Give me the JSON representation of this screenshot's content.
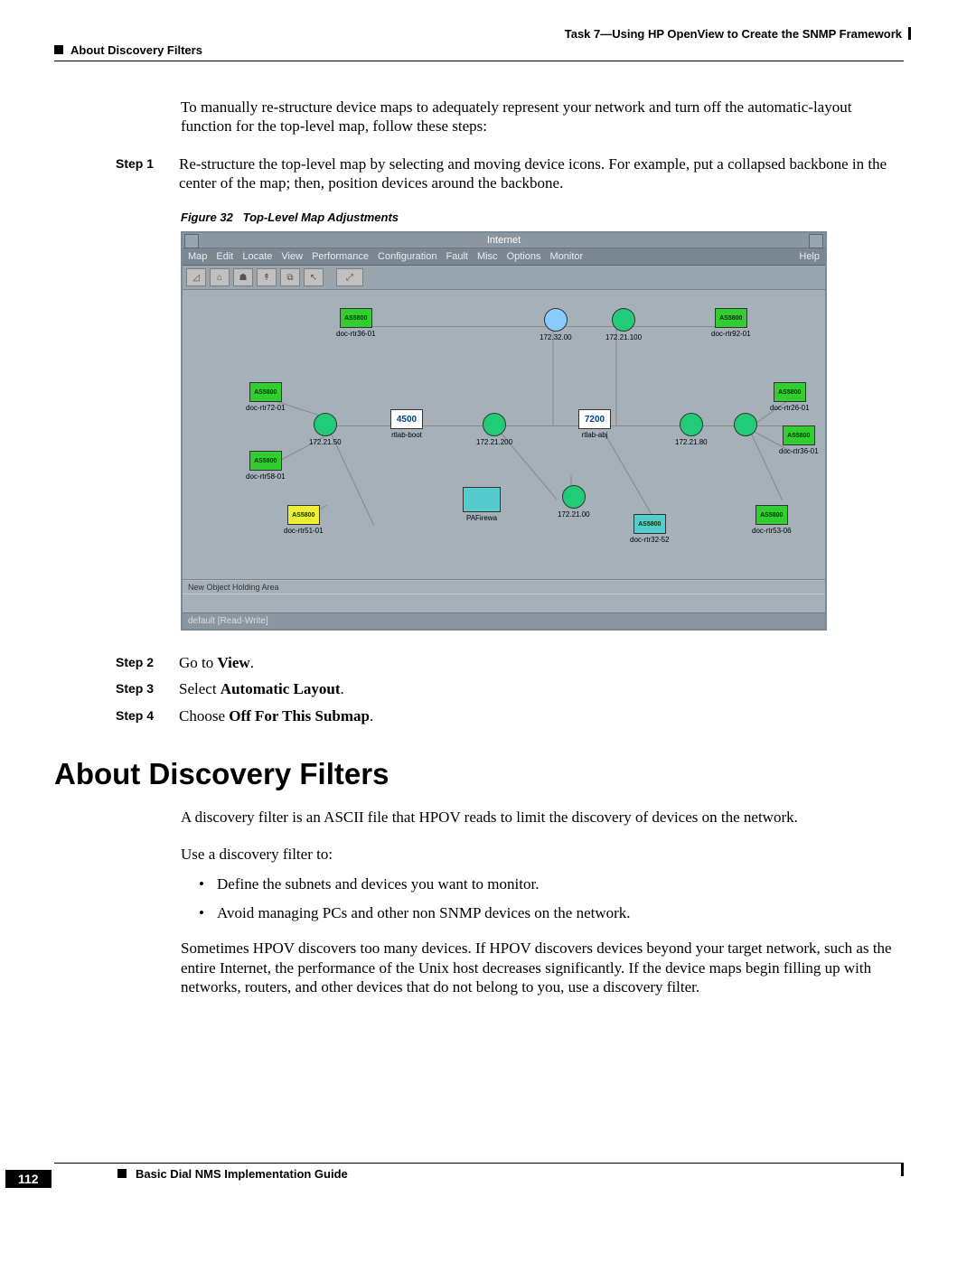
{
  "header": {
    "left": "About Discovery Filters",
    "right": "Task 7—Using HP OpenView to Create the SNMP Framework"
  },
  "intro": "To manually re-structure device maps to adequately represent your network and turn off the automatic-layout function for the top-level map, follow these steps:",
  "steps": [
    {
      "label": "Step 1",
      "text_prefix": "Re-structure the top-level map by selecting and moving device icons. For example, put a collapsed backbone in the center of the map; then, position devices around the backbone."
    },
    {
      "label": "Step 2",
      "text_prefix": "Go to ",
      "bold": "View",
      "suffix": "."
    },
    {
      "label": "Step 3",
      "text_prefix": "Select ",
      "bold": "Automatic Layout",
      "suffix": "."
    },
    {
      "label": "Step 4",
      "text_prefix": "Choose ",
      "bold": "Off For This Submap",
      "suffix": "."
    }
  ],
  "figure": {
    "label": "Figure 32",
    "title": "Top-Level Map Adjustments",
    "window_title": "Internet",
    "menus": [
      "Map",
      "Edit",
      "Locate",
      "View",
      "Performance",
      "Configuration",
      "Fault",
      "Misc",
      "Options",
      "Monitor"
    ],
    "menu_help": "Help",
    "status_area": "New Object Holding Area",
    "status_bottom": "default [Read-Write]",
    "nodes": {
      "n1": "doc-rtr36-01",
      "n2": "172.32.00",
      "n3": "172.21.100",
      "n4": "doc-rtr92-01",
      "n5": "doc-rtr72-01",
      "n6": "172.21.50",
      "n7": "4500",
      "n8": "172.21.200",
      "n9": "7200",
      "n10": "172.21.80",
      "n11": "doc-rtr26-01",
      "n12": "doc-rtr58-01",
      "n13": "doc-rtr51-01",
      "n14": "172.21.00",
      "n15": "doc-rtr32-52",
      "n16": "doc-rtr36-01",
      "n17": "doc-rtr53-06",
      "n18": "PAFirewa",
      "n7b": "rtlab-boot",
      "n9b": "rtlab-abj"
    }
  },
  "section": {
    "heading": "About Discovery Filters",
    "p1": "A discovery filter is an ASCII file that HPOV reads to limit the discovery of devices on the network.",
    "p2": "Use a discovery filter to:",
    "bullets": [
      "Define the subnets and devices you want to monitor.",
      "Avoid managing PCs and other non SNMP devices on the network."
    ],
    "p3": "Sometimes HPOV discovers too many devices. If HPOV discovers devices beyond your target network, such as the entire Internet, the performance of the Unix host decreases significantly. If the device maps begin filling up with networks, routers, and other devices that do not belong to you, use a discovery filter."
  },
  "footer": {
    "title": "Basic Dial NMS Implementation Guide",
    "page": "112"
  }
}
